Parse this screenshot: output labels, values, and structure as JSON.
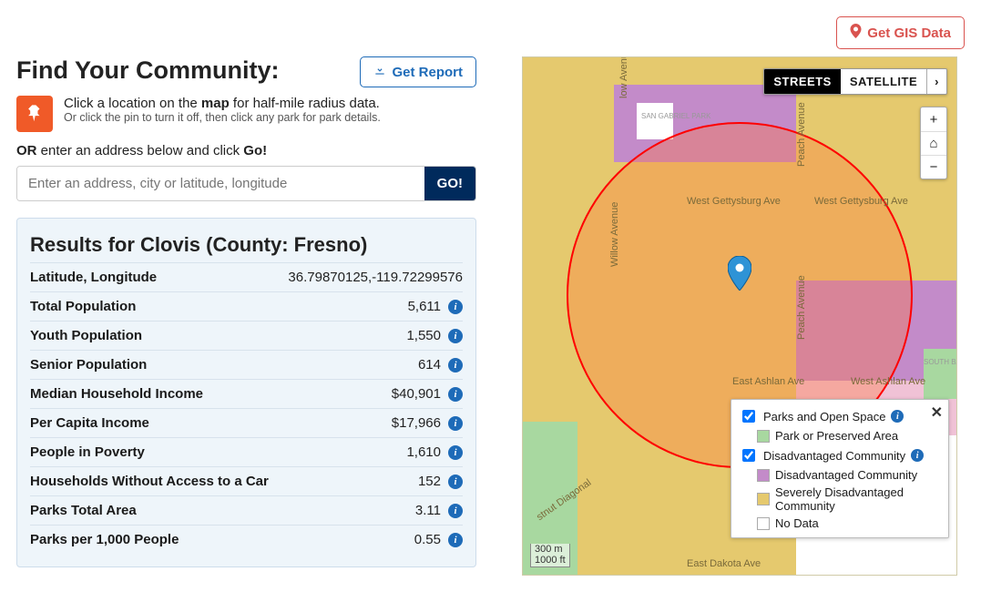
{
  "topbar": {
    "gis_label": "Get GIS Data"
  },
  "heading": "Find Your Community:",
  "get_report_label": "Get Report",
  "pin_hint": {
    "main_pre": "Click a location on the ",
    "main_bold": "map",
    "main_post": " for half-mile radius data.",
    "sub": "Or click the pin to turn it off, then click any park for park details."
  },
  "or_line": {
    "or": "OR",
    "mid": " enter an address below and click ",
    "go": "Go!"
  },
  "search": {
    "placeholder": "Enter an address, city or latitude, longitude",
    "button": "GO!"
  },
  "results": {
    "title": "Results for Clovis (County: Fresno)",
    "rows": [
      {
        "label": "Latitude, Longitude",
        "value": "36.79870125,-119.72299576",
        "info": false
      },
      {
        "label": "Total Population",
        "value": "5,611",
        "info": true
      },
      {
        "label": "Youth Population",
        "value": "1,550",
        "info": true
      },
      {
        "label": "Senior Population",
        "value": "614",
        "info": true
      },
      {
        "label": "Median Household Income",
        "value": "$40,901",
        "info": true
      },
      {
        "label": "Per Capita Income",
        "value": "$17,966",
        "info": true
      },
      {
        "label": "People in Poverty",
        "value": "1,610",
        "info": true
      },
      {
        "label": "Households Without Access to a Car",
        "value": "152",
        "info": true
      },
      {
        "label": "Parks Total Area",
        "value": "3.11",
        "info": true
      },
      {
        "label": "Parks per 1,000 People",
        "value": "0.55",
        "info": true
      }
    ]
  },
  "map": {
    "maptype": {
      "streets": "STREETS",
      "satellite": "SATELLITE"
    },
    "zoom": {
      "in": "+",
      "home": "⌂",
      "out": "−"
    },
    "scale": {
      "m": "300 m",
      "ft": "1000 ft"
    },
    "labels": {
      "gettysburg_l": "West Gettysburg Ave",
      "gettysburg_r": "West Gettysburg Ave",
      "ashlan_l": "East Ashlan Ave",
      "ashlan_r": "West Ashlan Ave",
      "dakota": "East Dakota Ave",
      "willow": "Willow Avenue",
      "willow2": "low Avenue",
      "peach": "Peach Avenue",
      "peach2": "Peach Avenue",
      "diag": "stnut Diagonal",
      "park": "SAN GABRIEL PARK",
      "basin": "SOUTH BASIN"
    },
    "legend": {
      "close": "✕",
      "group1_label": "Parks and Open Space",
      "group1_items": [
        {
          "label": "Park or Preserved Area",
          "color": "#a8d8a0"
        }
      ],
      "group2_label": "Disadvantaged Community",
      "group2_items": [
        {
          "label": "Disadvantaged Community",
          "color": "#c38bc9"
        },
        {
          "label": "Severely Disadvantaged Community",
          "color": "#e5c96e"
        },
        {
          "label": "No Data",
          "color": "#ffffff"
        }
      ]
    }
  }
}
